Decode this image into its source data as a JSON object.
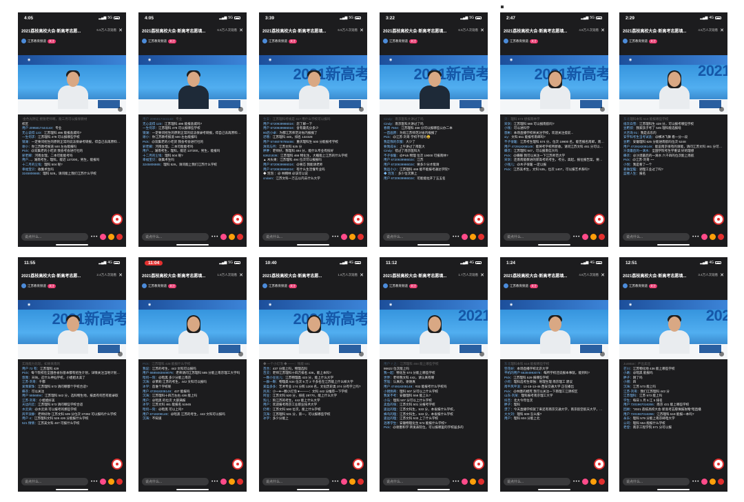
{
  "marker": "",
  "input_placeholder": "说点什么...",
  "phones": [
    {
      "time": "4:05",
      "net": "5G",
      "title": "2021荔枝高校大会·新高考志愿...",
      "viewers": "6.5万人次观看",
      "host": "江苏教育频道",
      "follow": "关注",
      "big": "",
      "person": "panel",
      "chat": [
        [
          "",
          ":金色光阴证 鲍锐老师啊，能三月可以报保教材"
        ],
        [
          "",
          "校区"
        ],
        [
          "用户 2095817444143：",
          "专业"
        ],
        [
          "无心说得 123：",
          "江苏理科 496 能报盐城吗?"
        ],
        [
          "一生何求：",
          "江苏理科 478 可以报哪些学校"
        ],
        [
          "镜湖：",
          "一定要问招生的原则正常的说法保录考研报，得自己去再原料研究，没人能告诉你多少分能选什么学校"
        ],
        [
          "谢小：",
          "你江苏教考报道 500 左右能报吗"
        ],
        [
          "Pick：",
          "@双集老的小吃货 我会考会进行社的"
        ],
        [
          "邪老脚：",
          "河南女理，二本可能能考吗"
        ],
        [
          "用户",
          "...，湖南考生，理科，能近 137200，男生，能报吗"
        ],
        [
          "十二月的尘埃：",
          "理科 504 呢?"
        ],
        [
          "幸福宝贝：",
          "收集术生吗"
        ],
        [
          "3245806665：",
          "理科 526，请问能上我们江苏什么学校"
        ]
      ]
    },
    {
      "time": "4:05",
      "net": "5G",
      "title": "2021荔枝高校大会·新高考志愿填...",
      "viewers": "6.5万人次观看",
      "host": "江苏教育频道",
      "follow": "关注",
      "big": "",
      "person": "suit",
      "chat": [
        [
          "用户 2095817444143：",
          "专业"
        ],
        [
          "无心说得 123：",
          "江苏理科 496 能报盐城吗?"
        ],
        [
          "一生何求：",
          "江苏理科 478 可以报哪些学校"
        ],
        [
          "镜湖：",
          "一定要问招生的原则正常的说法保录考研报，得自己去再原料研究，没人能告诉你多少分能选什么学校"
        ],
        [
          "谢小：",
          "你江苏教考报道 500 左右能报吗"
        ],
        [
          "Pick：",
          "@双集老的小吃货 我会考会进行社的"
        ],
        [
          "邪老脚：",
          "河南女理，二本可能能考吗"
        ],
        [
          "用户",
          "...，湖南考生，理科，能近 137200，男生，能报吗"
        ],
        [
          "十二月的尘埃：",
          "理科 504 呢?"
        ],
        [
          "幸福宝贝：",
          "收集术生吗"
        ],
        [
          "3245806665：",
          "理科 526，请问能上我们江苏什么学校"
        ]
      ]
    },
    {
      "time": "3:39",
      "net": "5G",
      "title": "2021荔枝高校大会·新高考志愿填...",
      "viewers": "6.5万人次观看",
      "host": "江苏教育频道",
      "follow": "关注",
      "big": "2021新高考",
      "person": "man",
      "chat": [
        [
          "生安：",
          "江苏理科考线是 417 用什么学校可以报吗"
        ],
        [
          "用户 6720939986024：",
          "您了解一下"
        ],
        [
          "用户 6720939986024：",
          "含有最先分多少"
        ],
        [
          "80后小卓：",
          "为都江苏师范对省内报报了"
        ],
        [
          "迟哦：",
          "江苏理科 446，排名 132328"
        ],
        [
          "用户 5746078785455：",
          "重庆理科生 500 分能报考学校"
        ],
        [
          "清风与月：",
          "江苏文科 525 分"
        ],
        [
          "胖胖：",
          "老师好，我理科 494 分，能什么专业有技好"
        ],
        [
          "63621836：",
          "江苏理科 466 物化生，大概能上江苏的什么学校"
        ],
        [
          "",
          "▲ 木头果：江苏理科 494 位次可以报报吗"
        ],
        [
          "用户 8720939986024：",
          "@要芯 我能请老师"
        ],
        [
          "用户 6720939986024：",
          "有什么生活懂专业吗"
        ],
        [
          "",
          "◆ 泡泡 ：@ 林桐林 @该可以说"
        ],
        [
          "crulam：",
          "江苏文科一万五以内去什么大学"
        ]
      ]
    },
    {
      "time": "3:22",
      "net": "5G",
      "title": "2021荔枝高校大会·新高考志愿填...",
      "viewers": "6.5万人次观看",
      "host": "江苏教育频道",
      "follow": "关注",
      "big": "2021新高考",
      "person": "suit",
      "chat": [
        [
          "Cindy：",
          "南京医科大讲过了吗"
        ],
        [
          "Cindy：",
          "南京医科大讲过了吗"
        ],
        [
          "春雨 7504：",
          "江苏理科 468 分可以报哪些公办二本"
        ],
        [
          "一首画原：",
          "为啥江苏师范对省内报报了"
        ],
        [
          "Pick：",
          "@江苏-刘哥 学校不错的😀"
        ],
        [
          "我是我的衣服：",
          "大少了"
        ],
        [
          "要我成长：",
          "上午讲过了南医大"
        ],
        [
          "Cindy：",
          "错过了南京医科大"
        ],
        [
          "不子很暖：",
          "@Pick 物理 位次 19000 可报南林?"
        ],
        [
          "用户 6720939986024：",
          "江苏"
        ],
        [
          "用户 6720939986024：",
          "要多少分才能请"
        ],
        [
          "我运小小：",
          "江苏理科 469 能不能报考通达学院?"
        ],
        [
          "◆ 泡泡 ：",
          "多少位次算上"
        ],
        [
          "用户 6720939986024：",
          "可能能拉开了五五名"
        ]
      ]
    },
    {
      "time": "2:47",
      "net": "5G",
      "title": "2021荔枝高校大会·新高考志愿填...",
      "viewers": "4.8万人次观看",
      "host": "江苏教育频道",
      "follow": "关注",
      "big": "2021新高考",
      "person": "woman",
      "chat": [
        [
          "贝：",
          "理科 573 想报南林学"
        ],
        [
          "宋剑：",
          "江苏理科 566 可以报南航吗?"
        ],
        [
          "小钱：",
          "可以进科学"
        ],
        [
          "悠彬：",
          "本场直播学校将关注学校，欢迎关注提前..."
        ],
        [
          "xiy：",
          "文科 551 能报考南邮吗?"
        ],
        [
          "不子很暖：",
          "江苏考生理科 574 分，位次 19900 名，能否报名南邮，南邮?"
        ],
        [
          "用户 472918208148：",
          "能将考学校所新收，请问江苏文科 461 分可以报在吗?"
        ],
        [
          "蝶衣：",
          "江苏理科 547，可以报南信大吗"
        ],
        [
          "Pick：",
          "@蝶蝶 我可以关注一下江苏师范大学"
        ],
        [
          "宋剑：",
          "还南南能教进的新高考的考生，考分，高起，报位报告案，要问于老师讨价"
        ],
        [
          "小钱儿：",
          "@木子很暖 一定以报"
        ],
        [
          "Pick：",
          "江苏美术生，文科 535，位次 1407，可以报艺术系吗?"
        ]
      ]
    },
    {
      "time": "2:29",
      "net": "4G",
      "title": "2021荔枝高校大会·新高考志愿填...",
      "viewers": "4.6万人次观看",
      "host": "江苏教育频道",
      "follow": "关注",
      "big": "2021",
      "person": "woman",
      "chat": [
        [
          "东北",
          "理科本科 518 能报哪些学校"
        ],
        [
          "纸灰白雪：",
          "江苏理科生 428 分，可以报考哪些学校"
        ],
        [
          "豆粑叔：",
          "我家孩子考了 545 理科能选报啥"
        ],
        [
          "大咨询 01：",
          "我是去东的"
        ],
        [
          "安宇科考生当考试盐：",
          "@横冰飞舞 看一分一段"
        ],
        [
          "豆粑：",
          "安徽理科 625 分能进南航吗位次 5248"
        ],
        [
          "用户 472918208148：",
          "能说南京很有的请能，请问江苏文科 461 分可以报谁吗?"
        ],
        [
          "沙漠最后的一滴水：",
          "全国学院考生学重读 好的理想"
        ],
        [
          "蝶衣：",
          "@沙漠最后的一滴水 六千四的位次能上南航"
        ],
        [
          "Pick：",
          "@江苏-刘哥 ~~"
        ],
        [
          "小悦：",
          "我是看了一个"
        ],
        [
          "靠微型脑：",
          "调理工业过了吗?"
        ],
        [
          "蓝楼人生：",
          "报名"
        ]
      ]
    },
    {
      "time": "11:55",
      "net": "4G",
      "title": "2021荔枝高校大会·新高考志愿...",
      "viewers": "2.4万人次观看",
      "host": "江苏教育频道",
      "follow": "关注",
      "big": "2021新高考",
      "person": "man",
      "chat": [
        [
          "",
          "实践能力比较，如果来南的"
        ],
        [
          "用户 72 有：",
          "江苏理科 429"
        ],
        [
          "Pick：",
          "每个院校在全国各省份基本都有招生计划，详情关注当地计划专刊"
        ],
        [
          "悠我：",
          "天呐，这什么神仙学校，小姐姐太美了"
        ],
        [
          "江苏-刘哥：",
          "干都"
        ],
        [
          "爱我家珠：",
          "江苏理科 573 请问哪都个学校合适?"
        ],
        [
          "蝶衣：",
          "可以关注"
        ],
        [
          "用户 5856894：",
          "江苏理科 542 分，选科物生地，报类有何否有能录取"
        ],
        [
          "江苏-刘哥：",
          "小姐姐好美"
        ],
        [
          "天边的云：",
          "江苏理科 573 请问哪些学校合适"
        ],
        [
          "水云滴：",
          "@水云滴 可以报考的那些学校"
        ],
        [
          "风平浪静：",
          "老师好你 江苏文科 509 分位次 37392 可以报吗什么学校"
        ],
        [
          "用户 4：",
          "江苏理科文科 526 426 分能报什么学校"
        ],
        [
          "521 情情：",
          "江苏美文科 467 可报什么学校"
        ]
      ]
    },
    {
      "time": "11:04",
      "net": "5G",
      "title": "2021荔枝高校大会·新高考志愿填...",
      "viewers": "1.8万人次观看",
      "host": "江苏教育频道",
      "follow": "关注",
      "big": "",
      "person": "woman",
      "redtime": true,
      "chat": [
        [
          "Pick：",
          "江苏理科 428 能报什么学校"
        ],
        [
          "我说：",
          "江苏的考生，442 文科可以报吗"
        ],
        [
          "用户 6689483849076：",
          "老师请问江苏理科 585 分能上南京理工大学吗"
        ],
        [
          "暗何一刻：",
          "@暗黑 多少分能上南京"
        ],
        [
          "沉海：",
          "@茉莉 江苏的考生，442 文科可以报吗"
        ],
        [
          "冰学：",
          "造谁个学校呢"
        ],
        [
          "用户 472918208148：",
          "437 能报吗"
        ],
        [
          "沉海：",
          "江苏理科十四万左右 436 能上吗"
        ],
        [
          "用户：",
          "@暗黑 的位次 大部满报"
        ],
        [
          "冰学：",
          "江苏文科 481 能报名 51945"
        ],
        [
          "暗何一刻：",
          "@暗黑 可以上吗?"
        ],
        [
          "用户 6718208148：",
          "@暗黑 江苏的考生，442 文科可以报吗"
        ],
        [
          "沉海：",
          "不知道"
        ]
      ]
    },
    {
      "time": "10:40",
      "net": "4G",
      "title": "2021荔枝高校大会·新高考志愿...",
      "viewers": "1.8万人次观看",
      "host": "江苏教育频道",
      "follow": "关注",
      "big": "2021新高考",
      "person": "woman",
      "chat": [
        [
          "",
          "◆ 一个小灯泡 ◆ ——：钱能 591"
        ],
        [
          "百合：",
          "437 分能上吗，物理选科"
        ],
        [
          "百灵：",
          "老师江苏理科十四万排名 436，能上本科?"
        ],
        [
          "一颗小豆豆儿：",
          "江苏物理类 423 分，能上什么大学"
        ],
        [
          "一群一颗：",
          "物理类 534 位次 5 万 2 千多名在江苏能上什么样大学"
        ],
        [
          "爱盈多多：",
          "艺术专业 174 分和 1200 名，文化历史类 374 分有学上吗?"
        ],
        [
          "风岚：",
          "小一♥一颗小灯泡 ♥一——：文科 442 分推荐一下学校"
        ],
        [
          "阿豆：",
          "江苏文科 520 分，排名 28770，能上什么大学"
        ],
        [
          "狗儿：",
          "狗江苏的考生，442 能上什么大学"
        ],
        [
          "用户：",
          "欢迎报考南京工业职业技术大学"
        ],
        [
          "仍熙：",
          "江苏文科 500 位次，能上什么学校"
        ],
        [
          "沉海：",
          "江苏理科 531 分，第一，可以报哪些学校"
        ],
        [
          "冰学：",
          "多少分能上"
        ]
      ]
    },
    {
      "time": "11:12",
      "net": "4G",
      "title": "2021荔枝高校大会·新高考志愿填...",
      "viewers": "1.7万人次观看",
      "host": "江苏教育频道",
      "follow": "关注",
      "big": "2021",
      "person": "woman",
      "chat": [
        [
          "用户 7 之：",
          "江苏理科 484 能上哪些学校"
        ],
        [
          "",
          "86622 位次能上吗"
        ],
        [
          "我一起：",
          "物化生 574 分能上哪些学校"
        ],
        [
          "世界：",
          "老师我文科 442，请认真有哪"
        ],
        [
          "苦恼：",
          "认真的，谢谢真"
        ],
        [
          "用户 474918208148：",
          "#32 能报考什么学校吗"
        ],
        [
          "小猪佩奇：",
          "理科 507 分可以上什么学校"
        ],
        [
          "我爱不考：",
          "安徽理科 556 能上么?"
        ],
        [
          "小马：",
          "理科 507 分可以上什么学校"
        ],
        [
          "卖鱼的张：",
          "江苏文科 501 分报考学校"
        ],
        [
          "遥远的理：",
          "江苏文科生，533 分，本省报什么学校，"
        ],
        [
          "蜂鸟的理：",
          "江苏文科生，533 分，本省报什么学校"
        ],
        [
          "遥远的理：",
          "江苏文科 533 上了什么学校"
        ],
        [
          "混寒学生：",
          "安徽物理化生 574 能报什么学校?"
        ],
        [
          "Pick：",
          "@谢墨和学 转发表院位，可以报哪里的学校居多的"
        ]
      ]
    },
    {
      "time": "1:24",
      "net": "4G",
      "title": "2021荔枝高校大会·新高考志愿填...",
      "viewers": "4.8万人次观看",
      "host": "江苏教育频道",
      "follow": "关注",
      "big": "",
      "person": "man",
      "chat": [
        [
          "东北",
          "理科本科 518 能报哪些学校"
        ],
        [
          "空花好：",
          "本场直播学校北京大学"
        ],
        [
          "平机的用户 66394993076：",
          "每所学校还说报本事就。能到吗?"
        ],
        [
          "Pick：",
          "江苏理科 529 报哪些学校"
        ],
        [
          "小何：",
          "理科选考生单独：地理生理 南京理工 建议"
        ],
        [
          "南平风平浪：",
          "13-15-13-45 西安交通大学 正在播出"
        ],
        [
          "Pick：",
          "@林墨的模死 我可以关注一下南理工江阴校区"
        ],
        [
          "山东-刘某：",
          "理科报考南京理工大学"
        ],
        [
          "抖音：",
          "北大今年位次"
        ],
        [
          "胖子：",
          "理科"
        ],
        [
          "漂了：",
          "今天直播学校就了来还有南京交通大学，南京航空航天大学，南京邮电大学，河海大学，南理工大学"
        ],
        [
          "大大刘：",
          "理科 608 怎么报?"
        ],
        [
          "用户：",
          "理科 604 分能上北"
        ]
      ]
    },
    {
      "time": "12:51",
      "net": "4G",
      "title": "2021荔枝高校大会·新高考志愿填...",
      "viewers": "3.4万人次观看",
      "host": "江苏教育频道",
      "follow": "关注",
      "big": "202",
      "person": "man",
      "chat": [
        [
          "",
          "JunMan：严出卖出"
        ],
        [
          "芒川：",
          "江苏物化地 436 能上哪些学校"
        ],
        [
          "小路：",
          "@暗黑 能报吗"
        ],
        [
          "胖子：",
          "刚了吗"
        ],
        [
          "小猪：",
          "四"
        ],
        [
          "沉海：",
          "江苏 573 能上吗"
        ],
        [
          "江苏-刘哥：",
          "我们江苏理科 442 分"
        ],
        [
          "江苏理科：",
          "江苏 573 能上吗"
        ],
        [
          "学生：",
          "每日 1 月 5 江 5 排名"
        ],
        [
          "用户 7201967016355：",
          "南京 431 能上哪些学校"
        ],
        [
          "回顾：",
          "\"2021 荔枝高校大会·新高考志愿填报攻略\"暗直播"
        ],
        [
          "用户 7201967016355：",
          "江苏理科 519 能报一本吗?"
        ],
        [
          "永乐：",
          "理科 579 分能上南京邮电大学"
        ],
        [
          "公司：",
          "理科 554 能报什么学校"
        ],
        [
          "老登：",
          "南京工程学院 571 分可以报"
        ]
      ]
    }
  ]
}
